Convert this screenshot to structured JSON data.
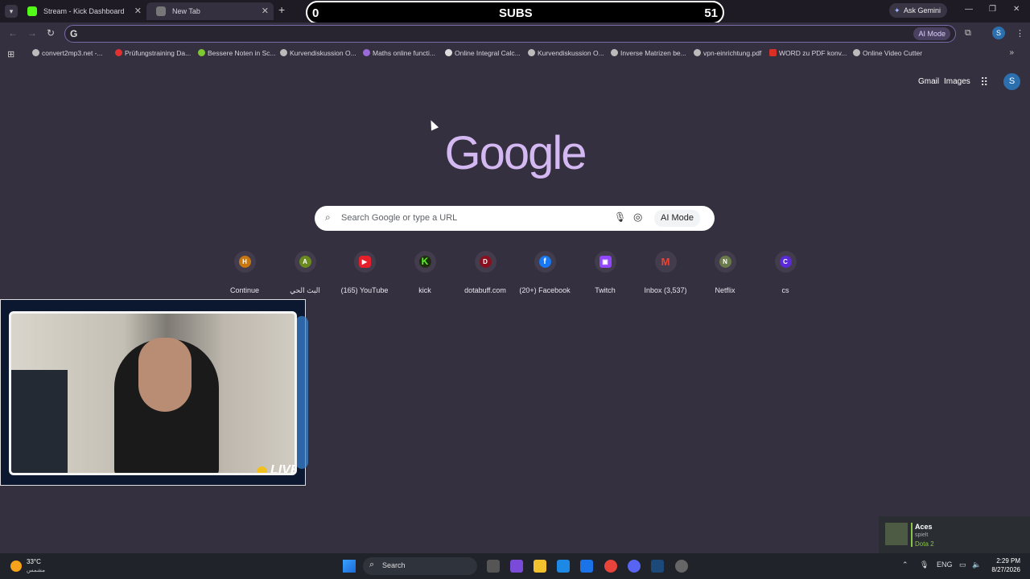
{
  "tabs": [
    {
      "title": "Stream - Kick Dashboard",
      "favicon_color": "#53fc18"
    },
    {
      "title": "New Tab",
      "favicon_color": "#888888"
    }
  ],
  "overlay": {
    "subs_left": "0",
    "subs_label": "SUBS",
    "subs_right": "51"
  },
  "gemini_label": "Ask Gemini",
  "omnibox": {
    "value": "",
    "ai_mode": "AI Mode"
  },
  "bookmarks": [
    {
      "label": "convert2mp3.net -...",
      "color": "#bbbbbb"
    },
    {
      "label": "Prüfungstraining Da...",
      "color": "#e03030"
    },
    {
      "label": "Bessere Noten in Sc...",
      "color": "#7ec832"
    },
    {
      "label": "Kurvendiskussion O...",
      "color": "#bbbbbb"
    },
    {
      "label": "Maths online functi...",
      "color": "#9a6ad8"
    },
    {
      "label": "Online Integral Calc...",
      "color": "#dddddd"
    },
    {
      "label": "Kurvendiskussion O...",
      "color": "#bbbbbb"
    },
    {
      "label": "Inverse Matrizen be...",
      "color": "#bbbbbb"
    },
    {
      "label": "vpn-einrichtung.pdf",
      "color": "#bbbbbb"
    },
    {
      "label": "WORD zu PDF konv...",
      "color": "#d93025"
    },
    {
      "label": "Online Video Cutter",
      "color": "#bbbbbb"
    }
  ],
  "top_links": {
    "gmail": "Gmail",
    "images": "Images",
    "account_initial": "S"
  },
  "logo_text": "Google",
  "search": {
    "placeholder": "Search Google or type a URL",
    "ai_mode": "AI Mode"
  },
  "shortcuts": [
    {
      "letter": "H",
      "label": "Continue",
      "color": "#c8760f"
    },
    {
      "letter": "A",
      "label": "البث الحي",
      "color": "#6a8a1f"
    },
    {
      "letter": "▶",
      "label": "(165) YouTube",
      "color": "#e5202a"
    },
    {
      "letter": "K",
      "label": "kick",
      "color": "#1f2e0f"
    },
    {
      "letter": "D",
      "label": "dotabuff.com",
      "color": "#8a1020"
    },
    {
      "letter": "f",
      "label": "(20+) Facebook",
      "color": "#1877f2"
    },
    {
      "letter": "T",
      "label": "Twitch",
      "color": "#9146ff"
    },
    {
      "letter": "M",
      "label": "Inbox (3,537)",
      "color": "#423c4c"
    },
    {
      "letter": "N",
      "label": "Netflix",
      "color": "#6b7a4a"
    },
    {
      "letter": "C",
      "label": "cs",
      "color": "#5a2ad8"
    }
  ],
  "webcam": {
    "live_label": "LIVE"
  },
  "notification": {
    "name": "Aces",
    "status": "spielt",
    "game": "Dota 2"
  },
  "taskbar": {
    "temp": "33°C",
    "weather_desc": "مشمس",
    "search_label": "Search",
    "lang": "ENG",
    "time": "2:29 PM",
    "date": "8/27/2026"
  }
}
